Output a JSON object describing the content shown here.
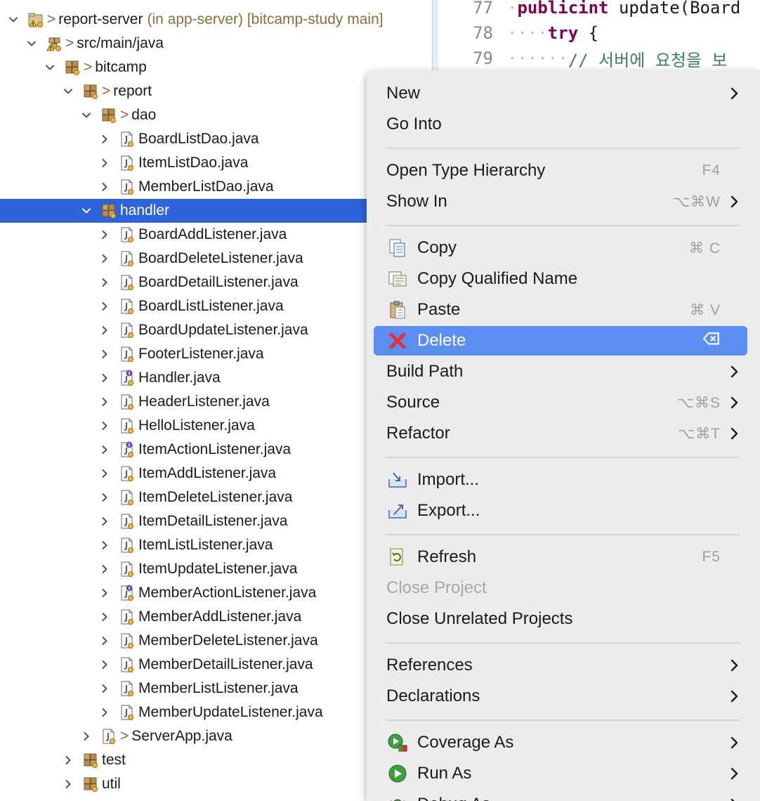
{
  "editor": {
    "lines": [
      {
        "number": "77",
        "indent": "·",
        "kw1": "public",
        "kw2": "int",
        "text": " update(Board"
      },
      {
        "number": "78",
        "indent": "····",
        "kw1": "try",
        "text": " {"
      },
      {
        "number": "79",
        "indent": "······",
        "comment": "// 서버에 요청을 보"
      }
    ]
  },
  "tree": {
    "rows": [
      {
        "level": 0,
        "expanded": true,
        "icon": "project-icon",
        "deco": ">",
        "label": "report-server",
        "extra": "(in app-server) [bitcamp-study main]"
      },
      {
        "level": 1,
        "expanded": true,
        "icon": "source-folder-icon",
        "deco": ">",
        "label": "src/main/java"
      },
      {
        "level": 2,
        "expanded": true,
        "icon": "package-icon",
        "deco": ">",
        "label": "bitcamp"
      },
      {
        "level": 3,
        "expanded": true,
        "icon": "package-icon",
        "deco": ">",
        "label": "report"
      },
      {
        "level": 4,
        "expanded": true,
        "icon": "package-icon",
        "deco": ">",
        "label": "dao"
      },
      {
        "level": 5,
        "expanded": false,
        "icon": "java-file-icon",
        "label": "BoardListDao.java"
      },
      {
        "level": 5,
        "expanded": false,
        "icon": "java-file-icon",
        "label": "ItemListDao.java"
      },
      {
        "level": 5,
        "expanded": false,
        "icon": "java-file-icon",
        "label": "MemberListDao.java"
      },
      {
        "level": 4,
        "expanded": true,
        "icon": "package-icon",
        "label": "handler",
        "selected": true
      },
      {
        "level": 5,
        "expanded": false,
        "icon": "java-file-icon",
        "label": "BoardAddListener.java"
      },
      {
        "level": 5,
        "expanded": false,
        "icon": "java-file-icon",
        "label": "BoardDeleteListener.java"
      },
      {
        "level": 5,
        "expanded": false,
        "icon": "java-file-icon",
        "label": "BoardDetailListener.java"
      },
      {
        "level": 5,
        "expanded": false,
        "icon": "java-file-icon",
        "label": "BoardListListener.java"
      },
      {
        "level": 5,
        "expanded": false,
        "icon": "java-file-icon",
        "label": "BoardUpdateListener.java"
      },
      {
        "level": 5,
        "expanded": false,
        "icon": "java-file-icon",
        "label": "FooterListener.java"
      },
      {
        "level": 5,
        "expanded": false,
        "icon": "java-interface-icon",
        "label": "Handler.java"
      },
      {
        "level": 5,
        "expanded": false,
        "icon": "java-file-icon",
        "label": "HeaderListener.java"
      },
      {
        "level": 5,
        "expanded": false,
        "icon": "java-file-icon",
        "label": "HelloListener.java"
      },
      {
        "level": 5,
        "expanded": false,
        "icon": "java-interface-icon",
        "label": "ItemActionListener.java"
      },
      {
        "level": 5,
        "expanded": false,
        "icon": "java-file-icon",
        "label": "ItemAddListener.java"
      },
      {
        "level": 5,
        "expanded": false,
        "icon": "java-file-icon",
        "label": "ItemDeleteListener.java"
      },
      {
        "level": 5,
        "expanded": false,
        "icon": "java-file-icon",
        "label": "ItemDetailListener.java"
      },
      {
        "level": 5,
        "expanded": false,
        "icon": "java-file-icon",
        "label": "ItemListListener.java"
      },
      {
        "level": 5,
        "expanded": false,
        "icon": "java-file-icon",
        "label": "ItemUpdateListener.java"
      },
      {
        "level": 5,
        "expanded": false,
        "icon": "java-interface-icon",
        "label": "MemberActionListener.java"
      },
      {
        "level": 5,
        "expanded": false,
        "icon": "java-file-icon",
        "label": "MemberAddListener.java"
      },
      {
        "level": 5,
        "expanded": false,
        "icon": "java-file-icon",
        "label": "MemberDeleteListener.java"
      },
      {
        "level": 5,
        "expanded": false,
        "icon": "java-file-icon",
        "label": "MemberDetailListener.java"
      },
      {
        "level": 5,
        "expanded": false,
        "icon": "java-file-icon",
        "label": "MemberListListener.java"
      },
      {
        "level": 5,
        "expanded": false,
        "icon": "java-file-icon",
        "label": "MemberUpdateListener.java"
      },
      {
        "level": 4,
        "expanded": false,
        "icon": "java-file-icon",
        "deco": ">",
        "label": "ServerApp.java"
      },
      {
        "level": 3,
        "expanded": false,
        "icon": "package-icon",
        "label": "test"
      },
      {
        "level": 3,
        "expanded": false,
        "icon": "package-icon",
        "label": "util"
      }
    ]
  },
  "menu": {
    "items": [
      {
        "type": "item",
        "label": "New",
        "submenu": true
      },
      {
        "type": "item",
        "label": "Go Into"
      },
      {
        "type": "sep"
      },
      {
        "type": "item",
        "label": "Open Type Hierarchy",
        "shortcut": "F4"
      },
      {
        "type": "item",
        "label": "Show In",
        "shortcut": "⌥⌘W",
        "submenu": true
      },
      {
        "type": "sep"
      },
      {
        "type": "item",
        "label": "Copy",
        "icon": "copy-icon",
        "shortcut": "⌘ C"
      },
      {
        "type": "item",
        "label": "Copy Qualified Name",
        "icon": "copy-qualified-name-icon"
      },
      {
        "type": "item",
        "label": "Paste",
        "icon": "paste-icon",
        "shortcut": "⌘ V"
      },
      {
        "type": "item",
        "label": "Delete",
        "icon": "delete-icon",
        "shortcut": "⌦",
        "highlight": true
      },
      {
        "type": "item",
        "label": "Build Path",
        "submenu": true
      },
      {
        "type": "item",
        "label": "Source",
        "shortcut": "⌥⌘S",
        "submenu": true
      },
      {
        "type": "item",
        "label": "Refactor",
        "shortcut": "⌥⌘T",
        "submenu": true
      },
      {
        "type": "sep"
      },
      {
        "type": "item",
        "label": "Import...",
        "icon": "import-icon"
      },
      {
        "type": "item",
        "label": "Export...",
        "icon": "export-icon"
      },
      {
        "type": "sep"
      },
      {
        "type": "item",
        "label": "Refresh",
        "icon": "refresh-icon",
        "shortcut": "F5"
      },
      {
        "type": "item",
        "label": "Close Project",
        "disabled": true
      },
      {
        "type": "item",
        "label": "Close Unrelated Projects"
      },
      {
        "type": "sep"
      },
      {
        "type": "item",
        "label": "References",
        "submenu": true
      },
      {
        "type": "item",
        "label": "Declarations",
        "submenu": true
      },
      {
        "type": "sep"
      },
      {
        "type": "item",
        "label": "Coverage As",
        "icon": "coverage-icon",
        "submenu": true
      },
      {
        "type": "item",
        "label": "Run As",
        "icon": "run-icon",
        "submenu": true
      },
      {
        "type": "item",
        "label": "Debug As",
        "icon": "debug-icon",
        "submenu": true
      }
    ]
  },
  "colors": {
    "selection": "#2e63d9",
    "menu_highlight": "#5a8ef0",
    "menu_bg": "#ececec"
  }
}
